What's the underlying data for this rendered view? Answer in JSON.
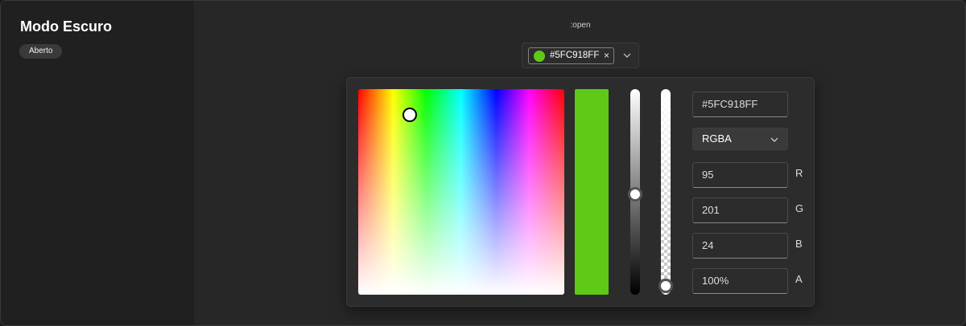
{
  "sidebar": {
    "title": "Modo Escuro",
    "badge": "Aberto"
  },
  "main": {
    "state_label": ":open"
  },
  "color_field": {
    "tag_text": "#5FC918FF",
    "tag_remove_icon": "close-icon",
    "dropdown_icon": "chevron-down-icon",
    "color": "#5FC918"
  },
  "picker": {
    "hex_value": "#5FC918FF",
    "mode": "RGBA",
    "mode_icon": "chevron-down-icon",
    "channels": [
      {
        "label": "R",
        "value": "95"
      },
      {
        "label": "G",
        "value": "201"
      },
      {
        "label": "B",
        "value": "24"
      },
      {
        "label": "A",
        "value": "100%"
      }
    ],
    "preview_color": "#5FC918",
    "lightness_level": 0.5,
    "alpha_level": 1.0
  },
  "colors": {
    "page_bg": "#272727",
    "sidebar_bg": "#202020",
    "selected": "#5FC918"
  }
}
